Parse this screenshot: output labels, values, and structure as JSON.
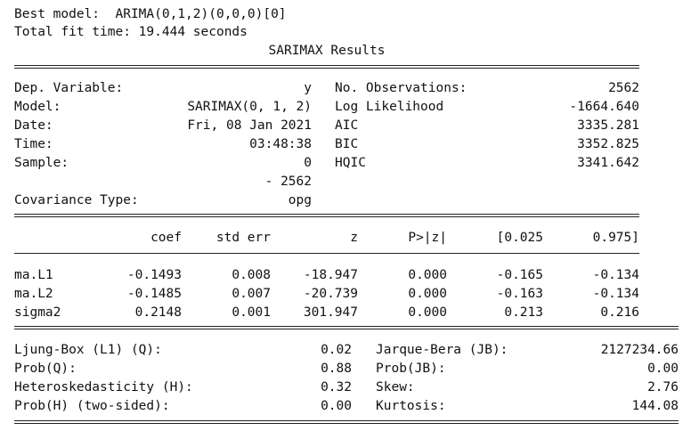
{
  "header": {
    "best_model": "Best model:  ARIMA(0,1,2)(0,0,0)[0]",
    "fit_time": "Total fit time: 19.444 seconds",
    "title": "SARIMAX Results"
  },
  "info": {
    "left": [
      {
        "label": "Dep. Variable:",
        "value": "y"
      },
      {
        "label": "Model:",
        "value": "SARIMAX(0, 1, 2)"
      },
      {
        "label": "Date:",
        "value": "Fri, 08 Jan 2021"
      },
      {
        "label": "Time:",
        "value": "03:48:38"
      },
      {
        "label": "Sample:",
        "value": "0"
      },
      {
        "label": "",
        "value": "- 2562"
      },
      {
        "label": "Covariance Type:",
        "value": "opg"
      }
    ],
    "right": [
      {
        "label": "No. Observations:",
        "value": "2562"
      },
      {
        "label": "Log Likelihood",
        "value": "-1664.640"
      },
      {
        "label": "AIC",
        "value": "3335.281"
      },
      {
        "label": "BIC",
        "value": "3352.825"
      },
      {
        "label": "HQIC",
        "value": "3341.642"
      }
    ]
  },
  "coef_table": {
    "headers": [
      "coef",
      "std err",
      "z",
      "P>|z|",
      "[0.025",
      "0.975]"
    ],
    "rows": [
      {
        "name": "ma.L1",
        "values": [
          "-0.1493",
          "0.008",
          "-18.947",
          "0.000",
          "-0.165",
          "-0.134"
        ]
      },
      {
        "name": "ma.L2",
        "values": [
          "-0.1485",
          "0.007",
          "-20.739",
          "0.000",
          "-0.163",
          "-0.134"
        ]
      },
      {
        "name": "sigma2",
        "values": [
          "0.2148",
          "0.001",
          "301.947",
          "0.000",
          "0.213",
          "0.216"
        ]
      }
    ]
  },
  "diagnostics": {
    "left": [
      {
        "label": "Ljung-Box (L1) (Q):",
        "value": "0.02"
      },
      {
        "label": "Prob(Q):",
        "value": "0.88"
      },
      {
        "label": "Heteroskedasticity (H):",
        "value": "0.32"
      },
      {
        "label": "Prob(H) (two-sided):",
        "value": "0.00"
      }
    ],
    "right": [
      {
        "label": "Jarque-Bera (JB):",
        "value": "2127234.66"
      },
      {
        "label": "Prob(JB):",
        "value": "0.00"
      },
      {
        "label": "Skew:",
        "value": "2.76"
      },
      {
        "label": "Kurtosis:",
        "value": "144.08"
      }
    ]
  }
}
